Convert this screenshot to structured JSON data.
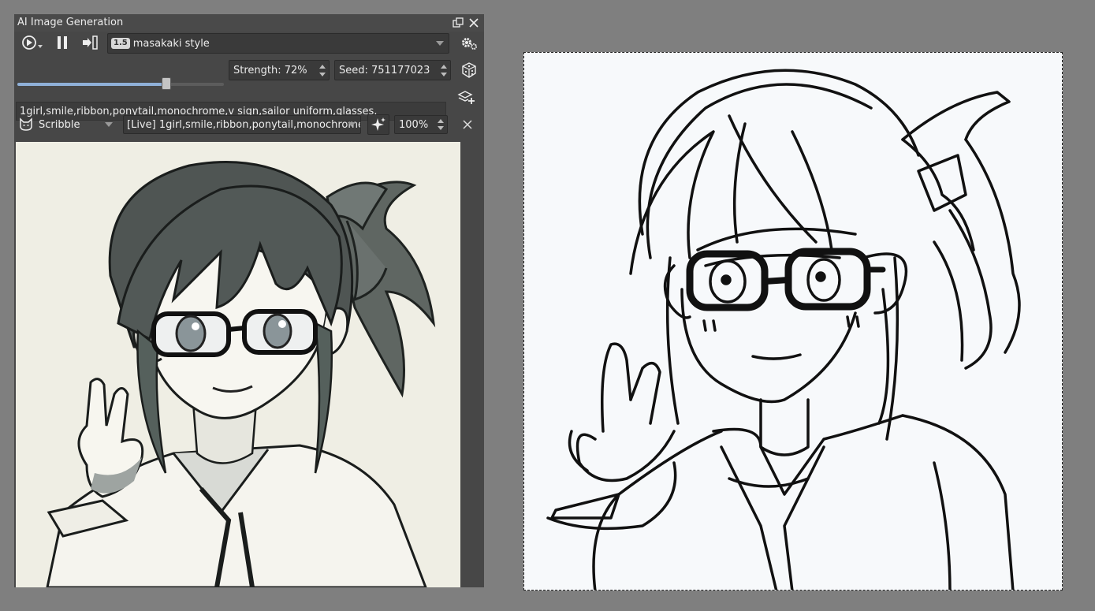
{
  "panel": {
    "title": "AI Image Generation",
    "toolbar": {
      "style_badge": "1.5",
      "style_label": "masakaki style"
    },
    "strength": {
      "label": "Strength: 72%",
      "value": 0.72
    },
    "seed": {
      "label": "Seed: 751177023"
    },
    "prompt": "1girl,smile,ribbon,ponytail,monochrome,v sign,sailor uniform,glasses,",
    "control": {
      "mode_label": "Scribble",
      "live_label": "[Live] 1girl,smile,ribbon,ponytail,monochrome",
      "zoom": "100%"
    }
  }
}
